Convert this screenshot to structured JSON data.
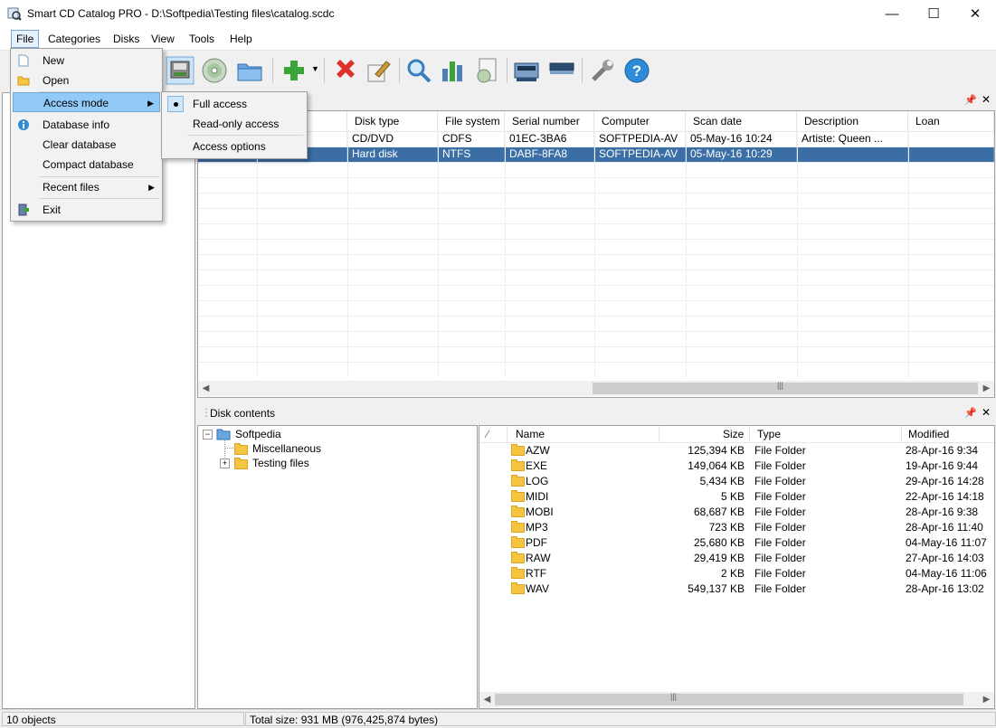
{
  "window": {
    "title": "Smart CD Catalog PRO - D:\\Softpedia\\Testing files\\catalog.scdc",
    "minimize": "—",
    "maximize": "☐",
    "close": "✕"
  },
  "menubar": [
    "File",
    "Categories",
    "Disks",
    "View",
    "Tools",
    "Help"
  ],
  "file_menu": {
    "new": "New",
    "open": "Open",
    "access_mode": "Access mode",
    "database_info": "Database info",
    "clear_database": "Clear database",
    "compact_database": "Compact database",
    "recent_files": "Recent files",
    "exit": "Exit"
  },
  "access_submenu": {
    "full_access": "Full access",
    "read_only": "Read-only access",
    "access_options": "Access options"
  },
  "disk_grid": {
    "columns": [
      "Disk type",
      "File system",
      "Serial number",
      "Computer",
      "Scan date",
      "Description",
      "Loan"
    ],
    "rows": [
      {
        "disk_type": "CD/DVD",
        "file_system": "CDFS",
        "serial": "01EC-3BA6",
        "computer": "SOFTPEDIA-AV",
        "scan_date": "05-May-16 10:24",
        "description": "Artiste: Queen ...",
        "loan": ""
      },
      {
        "disk_type": "Hard disk",
        "file_system": "NTFS",
        "serial": "DABF-8FA8",
        "computer": "SOFTPEDIA-AV",
        "scan_date": "05-May-16 10:29",
        "description": "",
        "loan": ""
      }
    ]
  },
  "disk_contents": {
    "title": "Disk contents",
    "tree": {
      "root": "Softpedia",
      "children": [
        "Miscellaneous",
        "Testing files"
      ]
    },
    "columns": [
      "Name",
      "Size",
      "Type",
      "Modified"
    ],
    "files": [
      {
        "name": "AZW",
        "size": "125,394 KB",
        "type": "File Folder",
        "modified": "28-Apr-16 9:34"
      },
      {
        "name": "EXE",
        "size": "149,064 KB",
        "type": "File Folder",
        "modified": "19-Apr-16 9:44"
      },
      {
        "name": "LOG",
        "size": "5,434 KB",
        "type": "File Folder",
        "modified": "29-Apr-16 14:28"
      },
      {
        "name": "MIDI",
        "size": "5 KB",
        "type": "File Folder",
        "modified": "22-Apr-16 14:18"
      },
      {
        "name": "MOBI",
        "size": "68,687 KB",
        "type": "File Folder",
        "modified": "28-Apr-16 9:38"
      },
      {
        "name": "MP3",
        "size": "723 KB",
        "type": "File Folder",
        "modified": "28-Apr-16 11:40"
      },
      {
        "name": "PDF",
        "size": "25,680 KB",
        "type": "File Folder",
        "modified": "04-May-16 11:07"
      },
      {
        "name": "RAW",
        "size": "29,419 KB",
        "type": "File Folder",
        "modified": "27-Apr-16 14:03"
      },
      {
        "name": "RTF",
        "size": "2 KB",
        "type": "File Folder",
        "modified": "04-May-16 11:06"
      },
      {
        "name": "WAV",
        "size": "549,137 KB",
        "type": "File Folder",
        "modified": "28-Apr-16 13:02"
      }
    ]
  },
  "statusbar": {
    "objects": "10 objects",
    "total": "Total size: 931 MB (976,425,874 bytes)"
  },
  "colors": {
    "selection": "#3b6ea5",
    "menu_highlight": "#91c9f7",
    "folder": "#f5c542"
  },
  "icons": {
    "toolbar": [
      "scan-disk-icon",
      "cd-icon",
      "open-folder-icon",
      "add-icon",
      "delete-icon",
      "edit-icon",
      "search-icon",
      "statistics-icon",
      "report-icon",
      "drive-icon",
      "drive-flat-icon",
      "tools-icon",
      "help-icon"
    ]
  }
}
